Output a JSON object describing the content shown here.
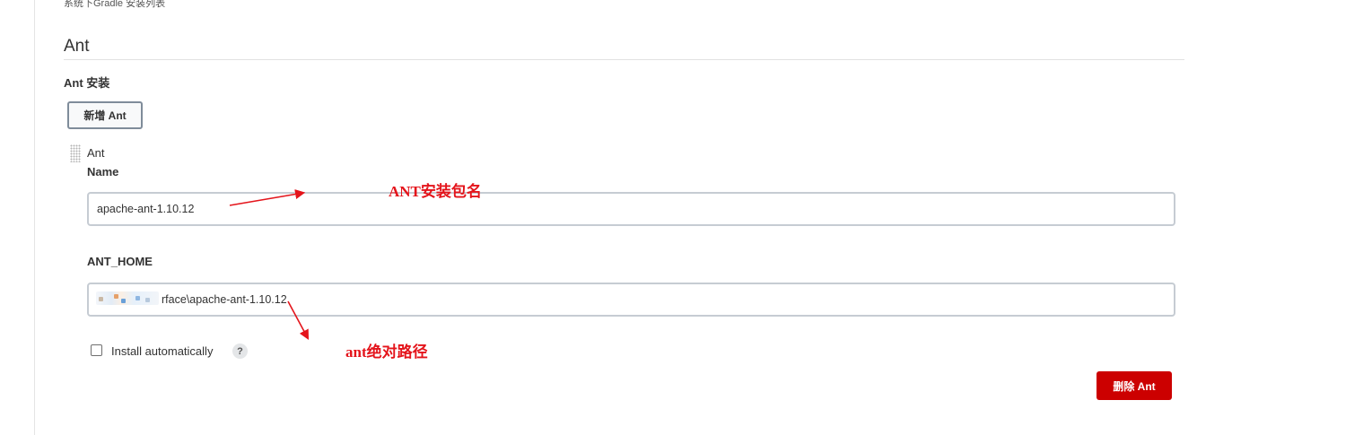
{
  "top_caption": "系统下Gradle 安装列表",
  "section": {
    "title": "Ant",
    "subtitle": "Ant 安装",
    "add_button": "新增 Ant"
  },
  "installation": {
    "header": "Ant",
    "name_label": "Name",
    "name_value": "apache-ant-1.10.12",
    "home_label": "ANT_HOME",
    "home_value_visible": "rface\\apache-ant-1.10.12",
    "install_auto_label": "Install automatically",
    "install_auto_checked": false,
    "help_icon": "?",
    "delete_button": "删除 Ant"
  },
  "annotations": {
    "name_note": "ANT安装包名",
    "home_note": "ant绝对路径",
    "color": "#e4141b"
  },
  "colors": {
    "delete_button_bg": "#cc0000",
    "input_border": "#c6ccd3"
  }
}
